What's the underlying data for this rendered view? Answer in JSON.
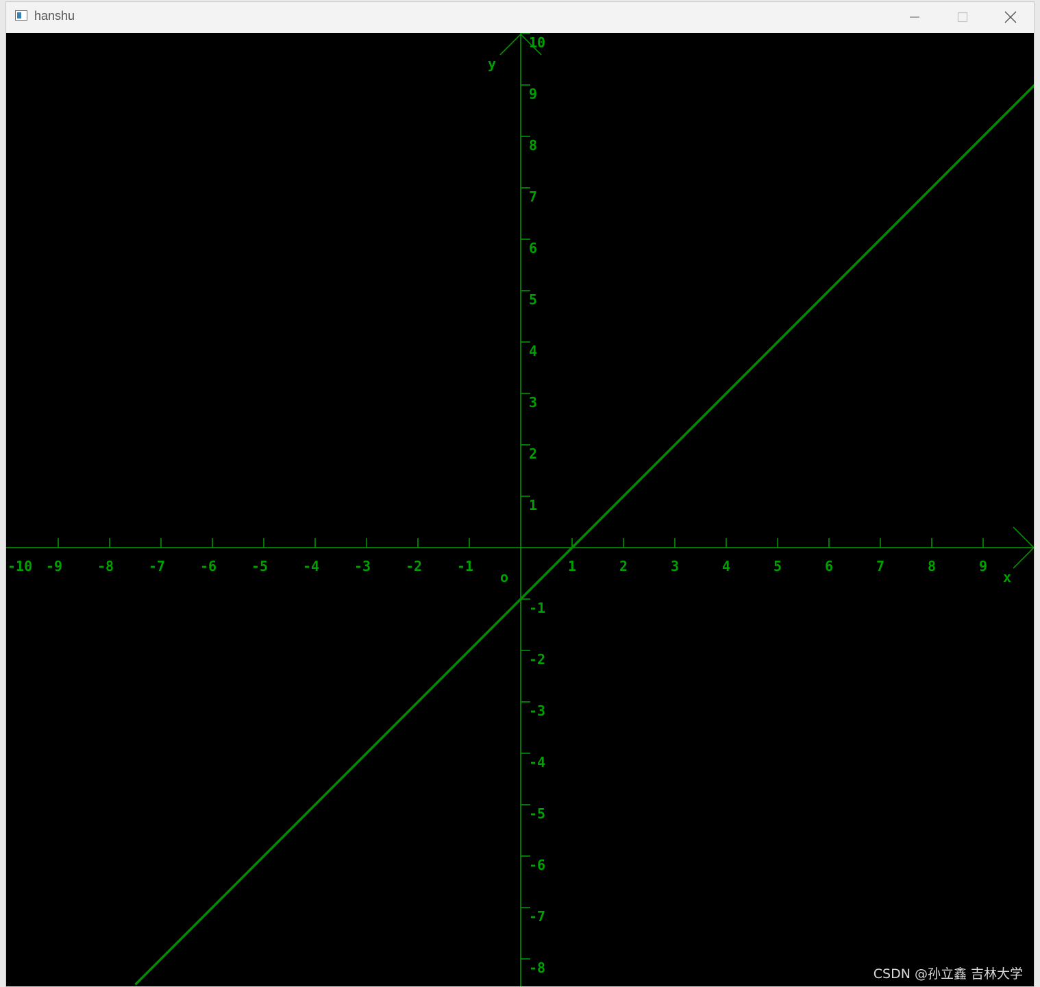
{
  "window": {
    "title": "hanshu",
    "icons": {
      "app": "console-window-icon",
      "minimize": "minimize-icon",
      "maximize": "maximize-icon",
      "close": "close-icon"
    }
  },
  "colors": {
    "background": "#000000",
    "axis": "#00a000",
    "line": "#008c00",
    "titlebar": "#f3f3f3"
  },
  "chart_data": {
    "type": "line",
    "title": "",
    "xlabel": "x",
    "ylabel": "y",
    "origin_label": "o",
    "xlim": [
      -10,
      10
    ],
    "ylim": [
      -8.5,
      10
    ],
    "x_ticks": [
      -10,
      -9,
      -8,
      -7,
      -6,
      -5,
      -4,
      -3,
      -2,
      -1,
      1,
      2,
      3,
      4,
      5,
      6,
      7,
      8,
      9
    ],
    "y_ticks": [
      10,
      9,
      8,
      7,
      6,
      5,
      4,
      3,
      2,
      1,
      -1,
      -2,
      -3,
      -4,
      -5,
      -6,
      -7,
      -8
    ],
    "grid": false,
    "series": [
      {
        "x": [
          -7.5,
          10
        ],
        "y": [
          -8.5,
          9
        ]
      }
    ]
  },
  "watermark": "CSDN @孙立鑫 吉林大学"
}
